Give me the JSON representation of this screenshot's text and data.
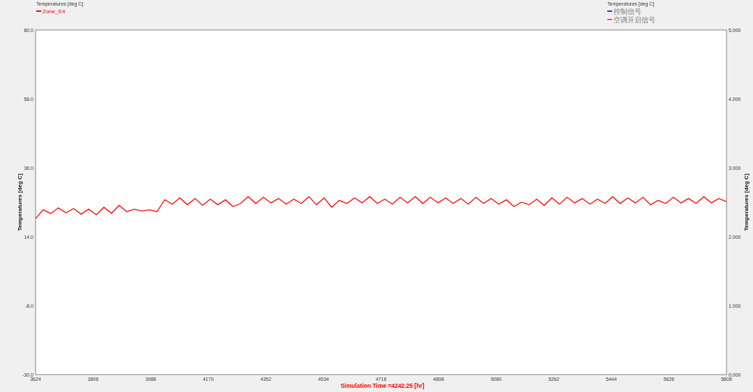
{
  "left_legend": {
    "title": "Temperatures  [deg C]"
  },
  "right_legend": {
    "title": "Temperatures  [deg C]",
    "items": [
      {
        "name": "控制信号",
        "color": "#3333cc"
      },
      {
        "name": "空调开启信号",
        "color": "#ff33ff"
      }
    ]
  },
  "right_axis": {
    "ylabel": "Temperatures  [deg C]",
    "yticks": [
      "5.000",
      "4.000",
      "3.000",
      "2.000",
      "1.000",
      "0.000"
    ]
  },
  "chart_data": {
    "type": "line",
    "xlabel": "Simulation Time =4242.25 [hr]",
    "ylabel": "Temperatures  [deg C]",
    "xlim": [
      3624,
      5808
    ],
    "ylim": [
      -30,
      80
    ],
    "xticks": [
      3624,
      3806,
      3988,
      4170,
      4352,
      4534,
      4716,
      4898,
      5080,
      5262,
      5444,
      5626,
      5808
    ],
    "yticks": [
      {
        "value": -30,
        "label": "-30.0"
      },
      {
        "value": -8,
        "label": "-8.0"
      },
      {
        "value": 14,
        "label": "14.0"
      },
      {
        "value": 36,
        "label": "36.0"
      },
      {
        "value": 58,
        "label": "58.0"
      },
      {
        "value": 80,
        "label": "80.0"
      }
    ],
    "x": [
      3624,
      3648,
      3672,
      3696,
      3720,
      3744,
      3768,
      3792,
      3816,
      3840,
      3864,
      3888,
      3912,
      3936,
      3960,
      3984,
      4008,
      4032,
      4056,
      4080,
      4104,
      4128,
      4152,
      4176,
      4200,
      4224,
      4248,
      4272,
      4296,
      4320,
      4344,
      4368,
      4392,
      4416,
      4440,
      4464,
      4488,
      4512,
      4536,
      4560,
      4584,
      4608,
      4632,
      4656,
      4680,
      4704,
      4728,
      4752,
      4776,
      4800,
      4824,
      4848,
      4872,
      4896,
      4920,
      4944,
      4968,
      4992,
      5016,
      5040,
      5064,
      5088,
      5112,
      5136,
      5160,
      5184,
      5208,
      5232,
      5256,
      5280,
      5304,
      5328,
      5352,
      5376,
      5400,
      5424,
      5448,
      5472,
      5496,
      5520,
      5544,
      5568,
      5592,
      5616,
      5640,
      5664,
      5688,
      5712,
      5736,
      5760,
      5784,
      5808
    ],
    "series": [
      {
        "name": "Zone_E4",
        "color": "#ff0000",
        "values": [
          19.8,
          22.6,
          21.4,
          23.2,
          21.6,
          23.0,
          21.2,
          22.8,
          21.0,
          23.4,
          21.5,
          24.0,
          22.0,
          22.8,
          22.2,
          22.6,
          22.0,
          25.8,
          24.4,
          26.4,
          24.2,
          26.2,
          24.0,
          26.0,
          24.2,
          25.8,
          23.6,
          24.6,
          26.8,
          24.6,
          26.6,
          24.8,
          26.2,
          24.4,
          26.0,
          24.6,
          26.8,
          24.2,
          26.4,
          23.4,
          25.6,
          24.6,
          26.4,
          24.8,
          26.8,
          24.6,
          26.0,
          24.4,
          26.6,
          24.8,
          26.8,
          24.6,
          26.6,
          24.8,
          26.4,
          24.6,
          26.2,
          24.4,
          26.6,
          24.6,
          26.2,
          24.4,
          25.8,
          23.6,
          25.0,
          24.2,
          26.0,
          24.0,
          26.4,
          24.4,
          26.6,
          24.8,
          26.2,
          24.4,
          26.0,
          24.6,
          26.8,
          24.6,
          26.4,
          24.8,
          26.6,
          24.2,
          25.6,
          24.6,
          26.6,
          24.8,
          26.2,
          24.6,
          26.8,
          24.8,
          26.2,
          25.2
        ]
      }
    ]
  }
}
